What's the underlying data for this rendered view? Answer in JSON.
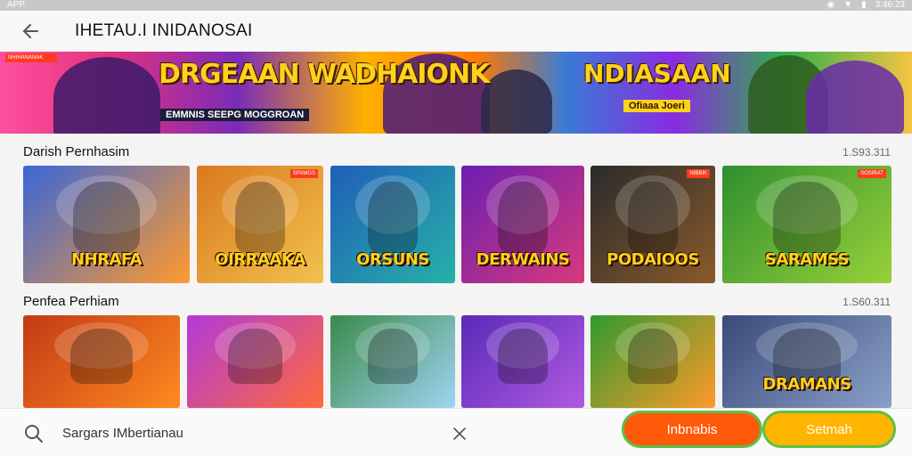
{
  "status_bar": {
    "app_label": "APP",
    "time": "3:46:23"
  },
  "header": {
    "title": "IHETAU.I INIDANOSAI"
  },
  "banner": {
    "tag": "NHIHANANAK",
    "title_1": "DRGEAAN WADHAIONK",
    "subtitle_1": "EMMNIS SEEPG MOGGROAN",
    "title_2": "NDIASAAN",
    "subtitle_2": "Ofiaaa Joeri"
  },
  "sections": [
    {
      "title": "Darish Pernhasim",
      "count": "1.S93.311",
      "cards": [
        {
          "label": "NHRAFA",
          "badge": "",
          "colors": [
            "#3a66d6",
            "#ff9a2e"
          ]
        },
        {
          "label": "OIRRAAKA",
          "badge": "SPAMGS",
          "colors": [
            "#d97a1f",
            "#f2c14e"
          ]
        },
        {
          "label": "ORSUNS",
          "badge": "",
          "colors": [
            "#1f5fb8",
            "#27b1a8"
          ]
        },
        {
          "label": "DERWAINS",
          "badge": "",
          "colors": [
            "#6a1fb0",
            "#d83a7a"
          ]
        },
        {
          "label": "PODAIOOS",
          "badge": "NIBBIK",
          "colors": [
            "#2b2b2b",
            "#8a5a2b"
          ]
        },
        {
          "label": "SARAMSS",
          "badge": "SOSIRAT",
          "colors": [
            "#2f8f2f",
            "#98d13a"
          ]
        }
      ]
    },
    {
      "title": "Penfea Perhiam",
      "count": "1.S60.311",
      "cards": [
        {
          "label": "",
          "badge": "",
          "colors": [
            "#c23a16",
            "#ff8a1f"
          ]
        },
        {
          "label": "",
          "badge": "",
          "colors": [
            "#b03ad8",
            "#ff6a3a"
          ]
        },
        {
          "label": "",
          "badge": "",
          "colors": [
            "#3a8a4a",
            "#9fd4f2"
          ]
        },
        {
          "label": "",
          "badge": "",
          "colors": [
            "#5a2ab8",
            "#b05ae0"
          ]
        },
        {
          "label": "",
          "badge": "",
          "colors": [
            "#2f9a2f",
            "#ff9a2a"
          ]
        },
        {
          "label": "DRAMANS",
          "badge": "",
          "colors": [
            "#3a4a7a",
            "#8aa0c8"
          ]
        }
      ]
    }
  ],
  "search": {
    "value": "Sargars IMbertianau"
  },
  "actions": {
    "primary_label": "Inbnabis",
    "secondary_label": "Setmah"
  }
}
